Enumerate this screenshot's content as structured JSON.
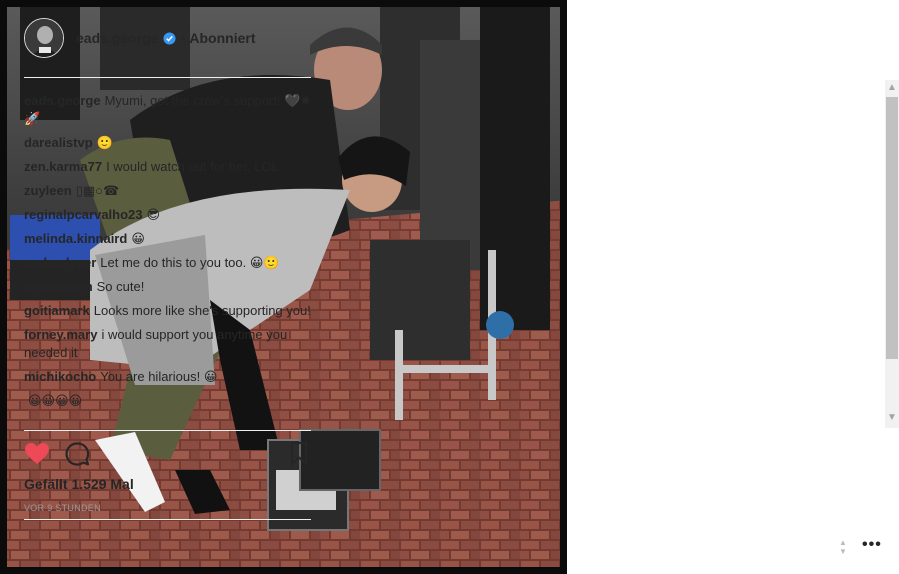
{
  "post": {
    "username": "eads.george",
    "separator": "•",
    "follow_status": "Abonniert",
    "likes": "Gefällt 1.529 Mal",
    "timestamp": "VOR 9 STUNDEN"
  },
  "comments": [
    {
      "user": "eads.george",
      "text": "Myumi, got the crew's support! 🖤✸🚀"
    },
    {
      "user": "darealistvp",
      "text": "🙂"
    },
    {
      "user": "zen.karma77",
      "text": "I would watch out for her, LOL"
    },
    {
      "user": "zuyleen",
      "text": "▯▦○☎"
    },
    {
      "user": "reginalpcarvalho23",
      "text": "😎"
    },
    {
      "user": "melinda.kinnaird",
      "text": "😀"
    },
    {
      "user": "carla.olyver",
      "text": "Let me do this to you too. 😀🙂"
    },
    {
      "user": "whiskween",
      "text": "So cute!"
    },
    {
      "user": "goitiamark",
      "text": "Looks more like she's supporting you!"
    },
    {
      "user": "forney.mary",
      "text": "i would support you anytime you needed it"
    },
    {
      "user": "michikocho",
      "text": "You are hilarious! 😀"
    },
    {
      "user": "",
      "text": "😀😀😀😀"
    }
  ],
  "icons": {
    "heart": "heart-icon",
    "comment": "comment-bubble-icon",
    "bookmark": "bookmark-icon",
    "verified": "verified-badge-icon",
    "more": "more-options-icon"
  },
  "more_label": "•••",
  "colors": {
    "heart": "#ed4956",
    "verified": "#3897f0",
    "text": "#262626",
    "muted": "#999999"
  }
}
